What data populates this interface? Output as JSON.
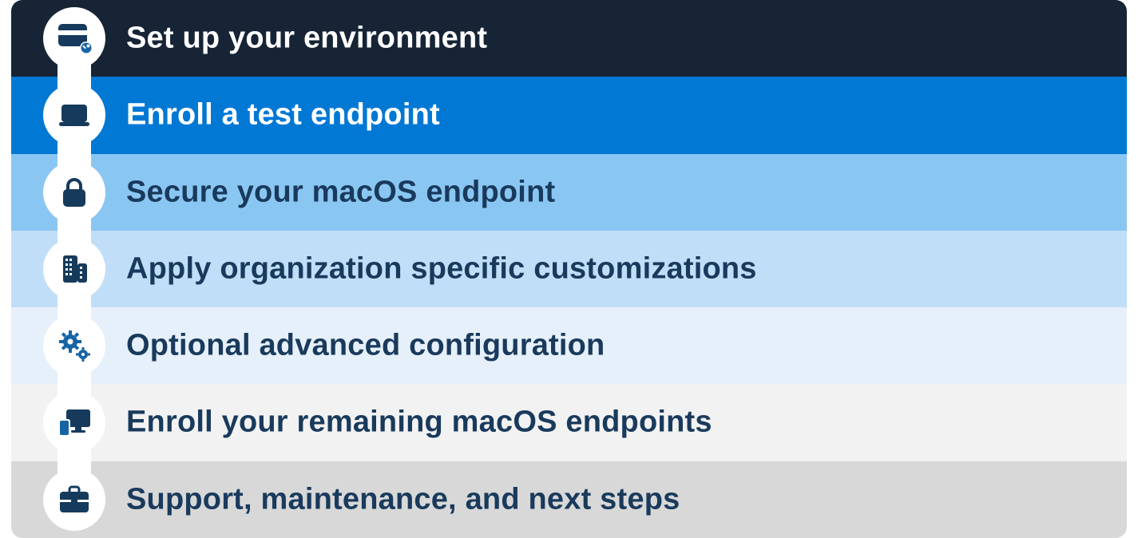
{
  "steps": [
    {
      "label": "Set up your environment",
      "bg": "#162436",
      "fg": "white",
      "icon": "card"
    },
    {
      "label": "Enroll a test endpoint",
      "bg": "#0078d4",
      "fg": "white",
      "icon": "laptop"
    },
    {
      "label": "Secure your macOS endpoint",
      "bg": "#8ac6f2",
      "fg": "dark",
      "icon": "lock"
    },
    {
      "label": "Apply organization specific customizations",
      "bg": "#c0def7",
      "fg": "dark",
      "icon": "building"
    },
    {
      "label": "Optional advanced configuration",
      "bg": "#e6f0fa",
      "fg": "dark",
      "icon": "gears"
    },
    {
      "label": "Enroll your remaining macOS endpoints",
      "bg": "#f2f2f2",
      "fg": "dark",
      "icon": "devices"
    },
    {
      "label": "Support, maintenance, and next steps",
      "bg": "#d8d8d8",
      "fg": "dark",
      "icon": "briefcase"
    }
  ],
  "colors": {
    "icon_dark": "#163a5c",
    "icon_blue": "#1664a5"
  }
}
